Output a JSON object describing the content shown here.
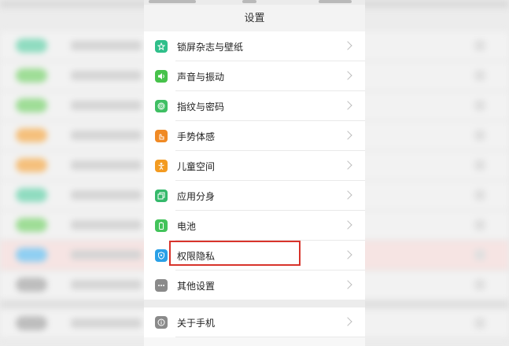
{
  "header": {
    "title": "设置"
  },
  "settings": {
    "items": [
      {
        "label": "锁屏杂志与壁纸",
        "icon": "wallpaper-icon",
        "color": "#2fbf8a"
      },
      {
        "label": "声音与振动",
        "icon": "speaker-icon",
        "color": "#47c24b"
      },
      {
        "label": "指纹与密码",
        "icon": "fingerprint-icon",
        "color": "#3fbf63"
      },
      {
        "label": "手势体感",
        "icon": "gesture-icon",
        "color": "#f08a25"
      },
      {
        "label": "儿童空间",
        "icon": "child-icon",
        "color": "#f39b21"
      },
      {
        "label": "应用分身",
        "icon": "app-clone-icon",
        "color": "#35b96b"
      },
      {
        "label": "电池",
        "icon": "battery-icon",
        "color": "#43c35a"
      },
      {
        "label": "权限隐私",
        "icon": "privacy-shield-icon",
        "color": "#2aa0e6"
      },
      {
        "label": "其他设置",
        "icon": "more-icon",
        "color": "#8a8a8a"
      },
      {
        "label": "关于手机",
        "icon": "info-icon",
        "color": "#8a8a8a"
      }
    ]
  },
  "highlight": {
    "color": "#d8332b",
    "target": "权限隐私"
  }
}
